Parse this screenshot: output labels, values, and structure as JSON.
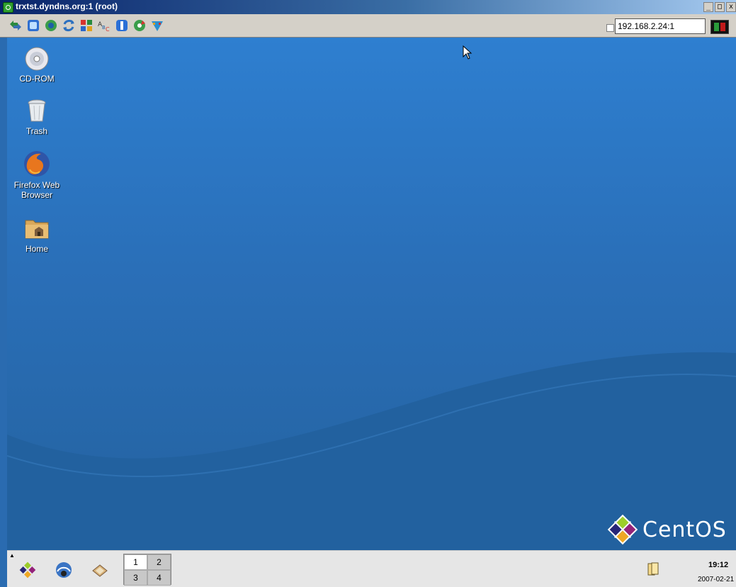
{
  "window": {
    "title": "trxtst.dyndns.org:1 (root)",
    "buttons": {
      "minimize": "_",
      "maximize": "□",
      "close": "x"
    }
  },
  "toolbar": {
    "icons": [
      "options-icon",
      "full-screen-icon",
      "refresh-icon",
      "reconnect-icon",
      "clipboard-icon",
      "text-chat-icon",
      "file-transfer-icon",
      "settings-icon",
      "extras-icon"
    ],
    "address": "192.168.2.24:1",
    "colors": {
      "led_ok": "#2a9a3a",
      "led_busy": "#c01a1a"
    }
  },
  "desktop": {
    "icons": [
      {
        "label": "CD-ROM",
        "icon": "cdrom-icon"
      },
      {
        "label": "Trash",
        "icon": "trash-icon"
      },
      {
        "label": "Firefox Web Browser",
        "label_line1": "Firefox Web",
        "label_line2": "Browser",
        "icon": "firefox-icon"
      },
      {
        "label": "Home",
        "icon": "home-folder-icon"
      }
    ],
    "logo_text": "CentOS"
  },
  "panel": {
    "launchers": [
      "main-menu-icon",
      "browser-icon",
      "file-manager-icon"
    ],
    "workspaces": [
      "1",
      "2",
      "3",
      "4"
    ],
    "active_workspace": "1",
    "clock_time": "19:12",
    "clock_date": "2007-02-21"
  }
}
